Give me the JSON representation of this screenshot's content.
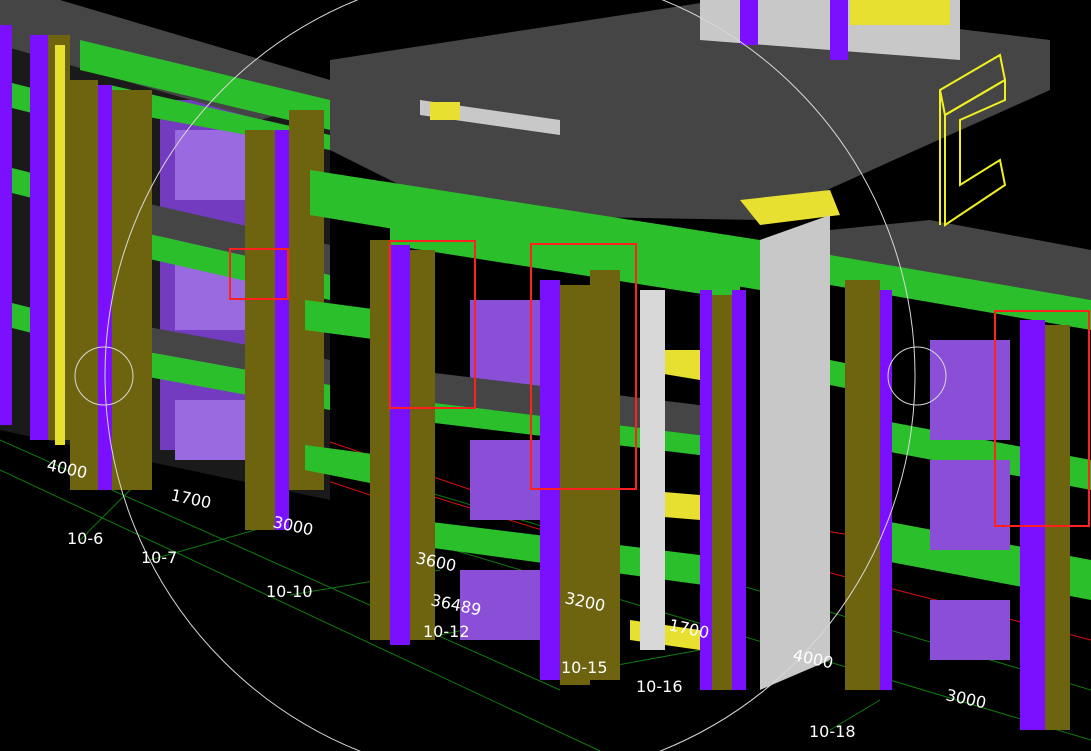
{
  "viewport": {
    "dimension_labels": [
      "4000",
      "1700",
      "3000",
      "3600",
      "36489",
      "3200",
      "1700",
      "4000",
      "3000"
    ],
    "axis_labels": [
      "10-6",
      "10-7",
      "10-10",
      "10-12",
      "10-15",
      "10-16",
      "10-18"
    ]
  },
  "colors": {
    "background": "#000000",
    "slab": "#454545",
    "beam": "#2cbf2c",
    "column": "#7a10ff",
    "wall": "#6e6410",
    "window": "#8a4fd6",
    "highlight_box": "#ff2020",
    "grid_line_red": "#e01010",
    "grid_line_green": "#0e7a0e",
    "orbit_circle": "#d8d8d8"
  }
}
